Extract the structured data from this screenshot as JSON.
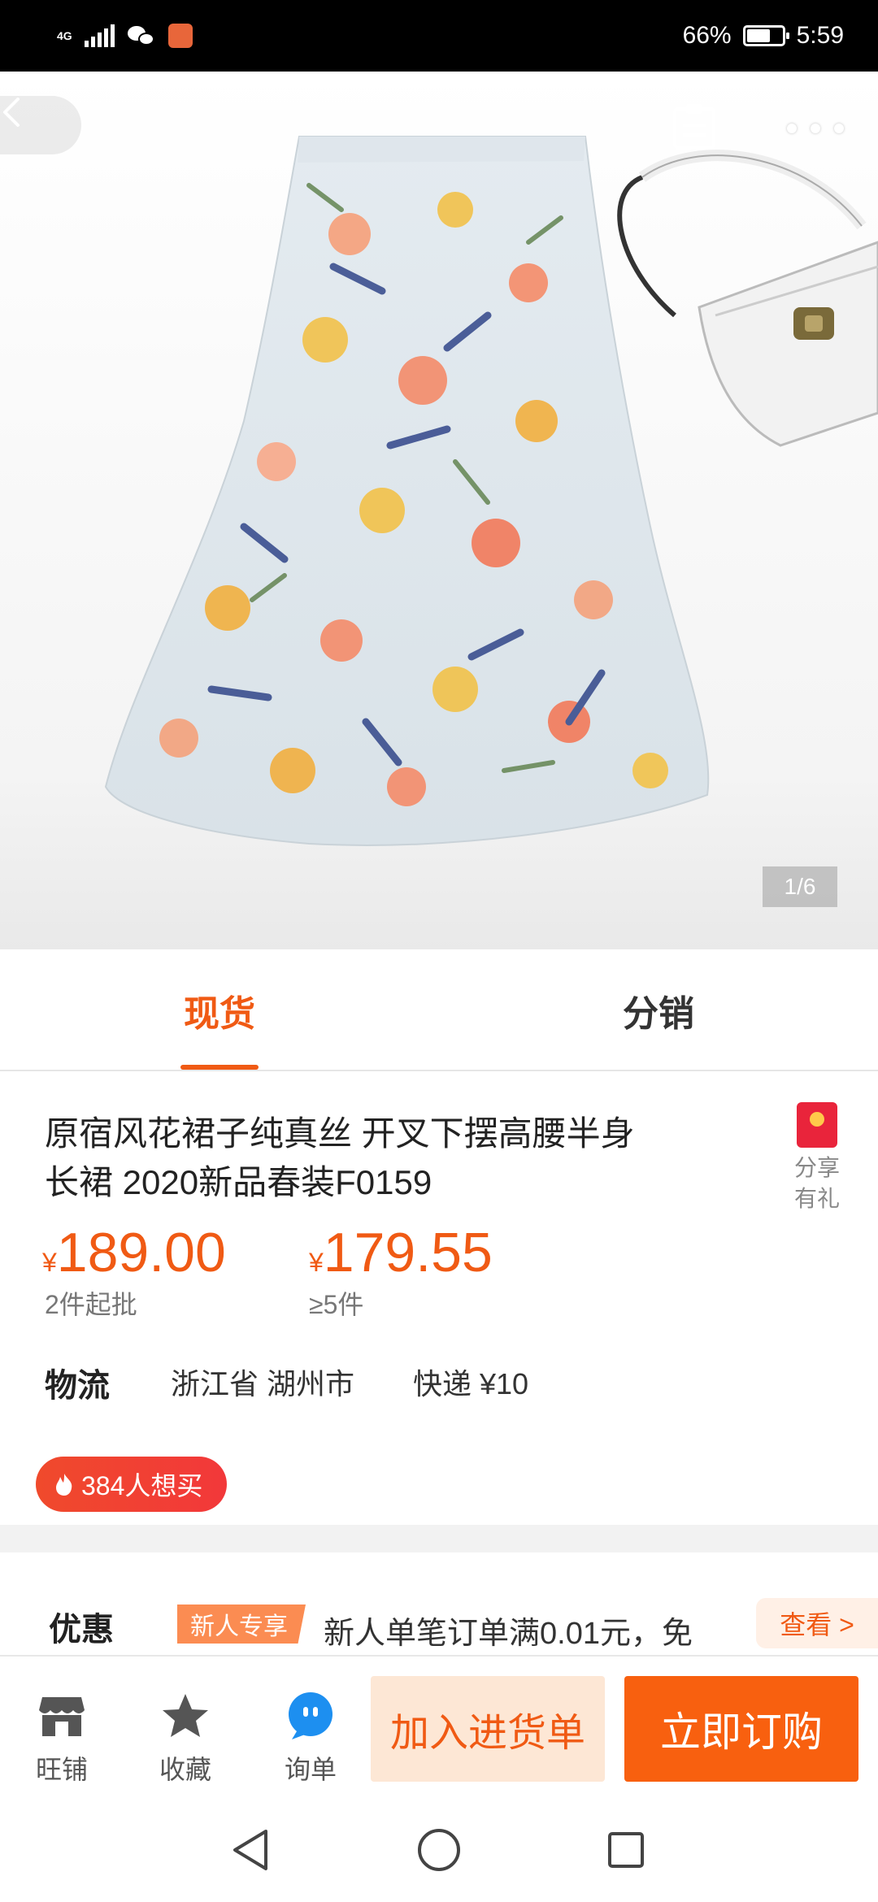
{
  "status_bar": {
    "network": "4G",
    "battery": "66%",
    "battery_level": 0.66,
    "time": "5:59"
  },
  "hero": {
    "page_indicator": "1/6",
    "icons": [
      "back-icon",
      "clipboard-icon",
      "more-icon"
    ]
  },
  "tabs": [
    {
      "label": "现货",
      "active": true
    },
    {
      "label": "分销",
      "active": false
    }
  ],
  "product": {
    "title_line1": "原宿风花裙子纯真丝 开叉下摆高腰半身",
    "title_line2": "长裙 2020新品春装F0159",
    "share_line1": "分享",
    "share_line2": "有礼",
    "prices": [
      {
        "currency": "¥",
        "value": "189.00",
        "condition": "2件起批"
      },
      {
        "currency": "¥",
        "value": "179.55",
        "condition": "≥5件"
      }
    ],
    "logistics_label": "物流",
    "logistics_location": "浙江省 湖州市",
    "logistics_shipping": "快递 ¥10",
    "want_to_buy": "384人想买"
  },
  "promo": {
    "label": "优惠",
    "tag": "新人专享",
    "text": "新人单笔订单满0.01元，免",
    "view": "查看 >"
  },
  "action_bar": {
    "shop": "旺铺",
    "favorite": "收藏",
    "inquiry": "询单",
    "add_to_cart": "加入进货单",
    "buy_now": "立即订购"
  },
  "colors": {
    "accent": "#f05a14",
    "buy_button": "#f8600f",
    "cart_button_bg": "#fde7d5",
    "hot_badge": "#f04a2c"
  }
}
